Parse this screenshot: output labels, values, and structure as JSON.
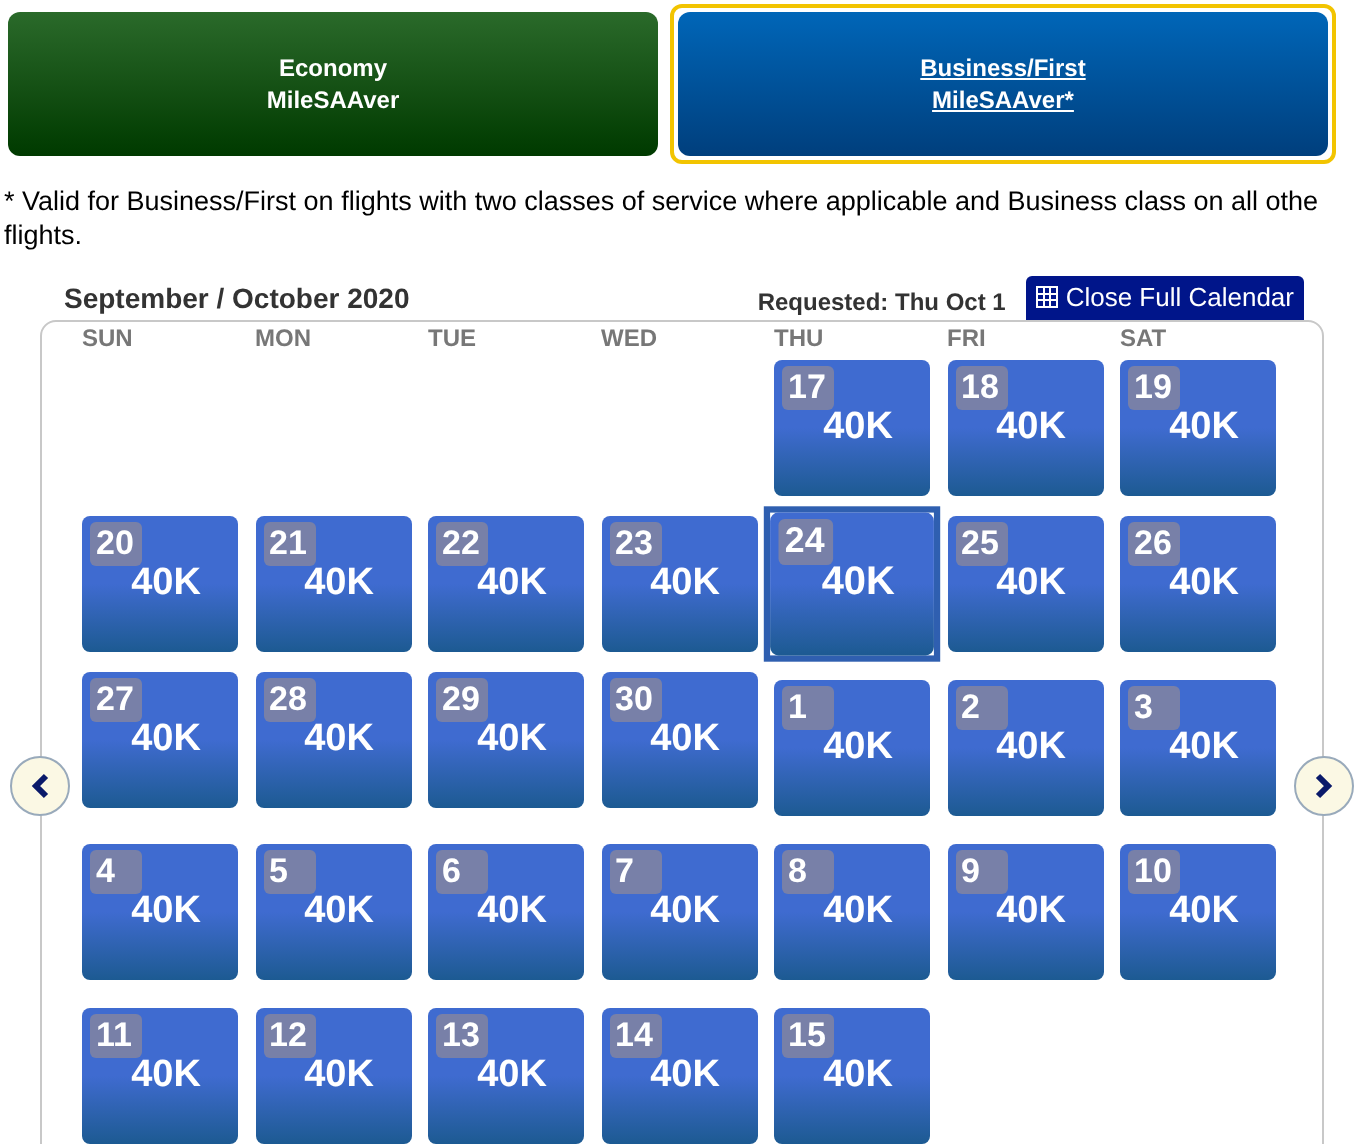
{
  "fare_tabs": [
    {
      "line1": "Economy",
      "line2": "MileSAAver",
      "selected": false
    },
    {
      "line1": "Business/First",
      "line2": "MileSAAver*",
      "selected": true
    }
  ],
  "footnote": "* Valid for Business/First on flights with two classes of service where applicable and Business class on all othe flights.",
  "calendar": {
    "title": "September / October 2020",
    "requested": "Requested: Thu Oct 1",
    "close_button": "Close Full Calendar",
    "weekdays": [
      "SUN",
      "MON",
      "TUE",
      "WED",
      "THU",
      "FRI",
      "SAT"
    ],
    "weeks": [
      [
        {
          "kind": "blank"
        },
        {
          "kind": "blank"
        },
        {
          "kind": "blank"
        },
        {
          "kind": "blank"
        },
        {
          "kind": "first_month",
          "day": "17",
          "price": "40K",
          "selected": false
        },
        {
          "kind": "first_month",
          "day": "18",
          "price": "40K",
          "selected": false
        },
        {
          "kind": "first_month",
          "day": "19",
          "price": "40K",
          "selected": false
        }
      ],
      [
        {
          "kind": "first_month",
          "day": "20",
          "price": "40K",
          "selected": false
        },
        {
          "kind": "first_month",
          "day": "21",
          "price": "40K",
          "selected": false
        },
        {
          "kind": "first_month",
          "day": "22",
          "price": "40K",
          "selected": false
        },
        {
          "kind": "first_month",
          "day": "23",
          "price": "40K",
          "selected": false
        },
        {
          "kind": "first_month",
          "day": "24",
          "price": "40K",
          "selected": true
        },
        {
          "kind": "first_month",
          "day": "25",
          "price": "40K",
          "selected": false
        },
        {
          "kind": "first_month",
          "day": "26",
          "price": "40K",
          "selected": false
        }
      ],
      [
        {
          "kind": "first_month",
          "day": "27",
          "price": "40K",
          "selected": false
        },
        {
          "kind": "first_month",
          "day": "28",
          "price": "40K",
          "selected": false
        },
        {
          "kind": "first_month",
          "day": "29",
          "price": "40K",
          "selected": false
        },
        {
          "kind": "first_month",
          "day": "30",
          "price": "40K",
          "selected": false
        },
        {
          "kind": "second_month",
          "day": "1",
          "price": "40K",
          "selected": false
        },
        {
          "kind": "second_month",
          "day": "2",
          "price": "40K",
          "selected": false
        },
        {
          "kind": "second_month",
          "day": "3",
          "price": "40K",
          "selected": false
        }
      ],
      [
        {
          "kind": "second_month",
          "day": "4",
          "price": "40K",
          "selected": false
        },
        {
          "kind": "second_month",
          "day": "5",
          "price": "40K",
          "selected": false
        },
        {
          "kind": "second_month",
          "day": "6",
          "price": "40K",
          "selected": false
        },
        {
          "kind": "second_month",
          "day": "7",
          "price": "40K",
          "selected": false
        },
        {
          "kind": "second_month",
          "day": "8",
          "price": "40K",
          "selected": false
        },
        {
          "kind": "second_month",
          "day": "9",
          "price": "40K",
          "selected": false
        },
        {
          "kind": "second_month",
          "day": "10",
          "price": "40K",
          "selected": false
        }
      ],
      [
        {
          "kind": "second_month",
          "day": "11",
          "price": "40K",
          "selected": false
        },
        {
          "kind": "second_month",
          "day": "12",
          "price": "40K",
          "selected": false
        },
        {
          "kind": "second_month",
          "day": "13",
          "price": "40K",
          "selected": false
        },
        {
          "kind": "second_month",
          "day": "14",
          "price": "40K",
          "selected": false
        },
        {
          "kind": "second_month",
          "day": "15",
          "price": "40K",
          "selected": false
        },
        {
          "kind": "blank"
        },
        {
          "kind": "blank"
        }
      ]
    ]
  }
}
